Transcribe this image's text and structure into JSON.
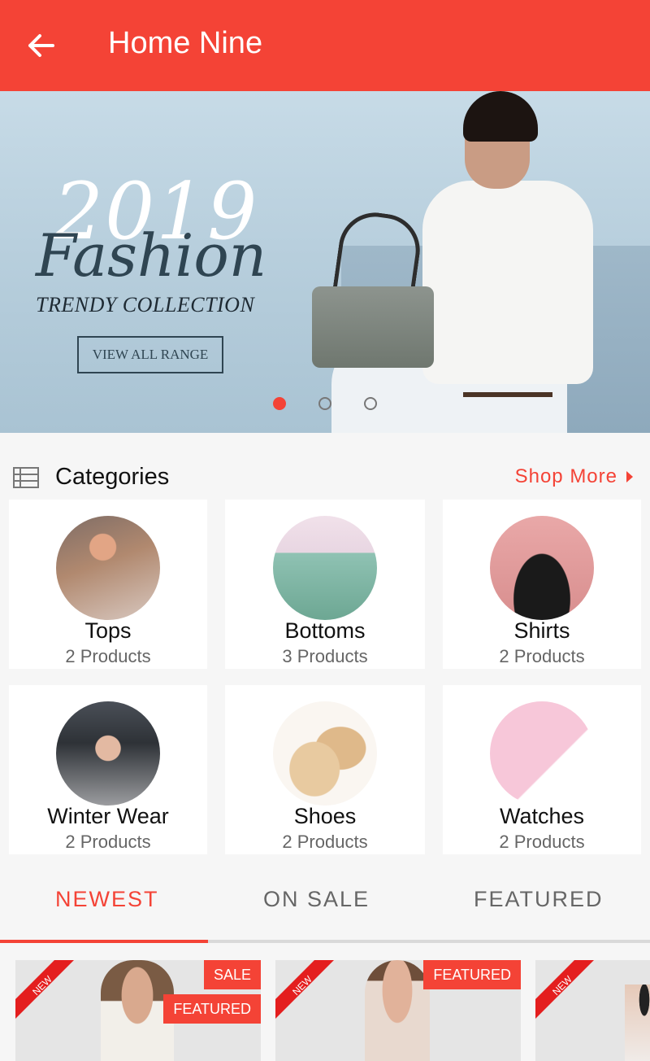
{
  "appbar": {
    "title": "Home Nine",
    "back_icon": "arrow-left-icon"
  },
  "banner": {
    "year": "2019",
    "headline": "Fashion",
    "subheadline": "TRENDY COLLECTION",
    "cta": "VIEW ALL RANGE",
    "slides": 3,
    "active_slide": 1
  },
  "categories": {
    "title": "Categories",
    "shop_more": "Shop More",
    "items": [
      {
        "name": "Tops",
        "count": "2 Products"
      },
      {
        "name": "Bottoms",
        "count": "3 Products"
      },
      {
        "name": "Shirts",
        "count": "2 Products"
      },
      {
        "name": "Winter Wear",
        "count": "2 Products"
      },
      {
        "name": "Shoes",
        "count": "2 Products"
      },
      {
        "name": "Watches",
        "count": "2 Products"
      }
    ]
  },
  "tabs": [
    {
      "label": "NEWEST",
      "active": true
    },
    {
      "label": "ON SALE",
      "active": false
    },
    {
      "label": "FEATURED",
      "active": false
    }
  ],
  "products": [
    {
      "ribbon": "NEW",
      "badges": [
        "SALE",
        "FEATURED"
      ]
    },
    {
      "ribbon": "NEW",
      "badges": [
        "FEATURED"
      ]
    },
    {
      "ribbon": "NEW",
      "badges": []
    }
  ],
  "colors": {
    "primary": "#f44336",
    "background": "#f6f6f6",
    "card": "#ffffff"
  }
}
